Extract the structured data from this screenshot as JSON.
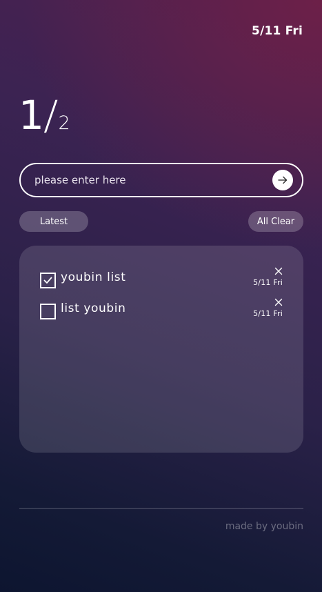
{
  "header": {
    "date": "5/11 Fri"
  },
  "counter": {
    "done": "1",
    "separator": "/",
    "total": "2"
  },
  "input": {
    "placeholder": "please enter here",
    "value": ""
  },
  "controls": {
    "sort_label": "Latest",
    "clear_label": "All Clear"
  },
  "todos": [
    {
      "text": "youbin list",
      "date": "5/11 Fri",
      "checked": true
    },
    {
      "text": "list youbin",
      "date": "5/11 Fri",
      "checked": false
    }
  ],
  "footer": {
    "credit": "made by youbin"
  },
  "icons": {
    "submit": "arrow-right-icon",
    "check": "check-icon",
    "delete": "close-icon"
  },
  "colors": {
    "text": "#ffffff",
    "background_top": "#6e2048",
    "background_bottom": "#0d1530",
    "pill": "#ffffff38"
  }
}
